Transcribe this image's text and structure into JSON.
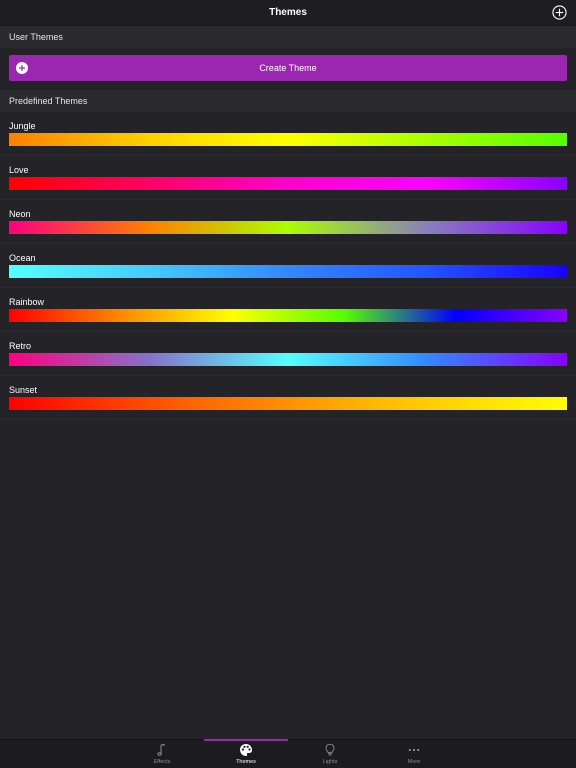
{
  "nav": {
    "title": "Themes",
    "add_icon": "plus-circle-icon"
  },
  "user_section": {
    "title": "User Themes",
    "create_label": "Create Theme",
    "create_icon": "plus-circle-icon",
    "button_color": "#9b27b0"
  },
  "predefined_section": {
    "title": "Predefined Themes"
  },
  "themes": [
    {
      "name": "Jungle",
      "colors": [
        "#ff8000",
        "#ffd000",
        "#ffff00",
        "#aaff00",
        "#55ff00"
      ]
    },
    {
      "name": "Love",
      "colors": [
        "#ff0000",
        "#ff0066",
        "#ff00cc",
        "#ff00ff",
        "#8800ff"
      ]
    },
    {
      "name": "Neon",
      "colors": [
        "#ff0080",
        "#ff8000",
        "#aaff00",
        "#8880bb",
        "#8800ff"
      ]
    },
    {
      "name": "Ocean",
      "colors": [
        "#55ffff",
        "#44ccff",
        "#3388ff",
        "#2255ff",
        "#1a00ff"
      ]
    },
    {
      "name": "Rainbow",
      "colors": [
        "#ff0000",
        "#ff8800",
        "#ffff00",
        "#55ff00",
        "#0000ff",
        "#8800ff"
      ]
    },
    {
      "name": "Retro",
      "colors": [
        "#ff0080",
        "#8870cc",
        "#55ffff",
        "#3388ff",
        "#8800ff"
      ]
    },
    {
      "name": "Sunset",
      "colors": [
        "#ff0000",
        "#ff6600",
        "#ffbb00",
        "#ffff00"
      ]
    }
  ],
  "tabs": [
    {
      "label": "Effects",
      "icon": "music-note-icon",
      "active": false
    },
    {
      "label": "Themes",
      "icon": "palette-icon",
      "active": true
    },
    {
      "label": "Lights",
      "icon": "lightbulb-icon",
      "active": false
    },
    {
      "label": "More",
      "icon": "more-dots-icon",
      "active": false
    }
  ],
  "colors": {
    "accent": "#9b27b0",
    "background": "#232328"
  }
}
